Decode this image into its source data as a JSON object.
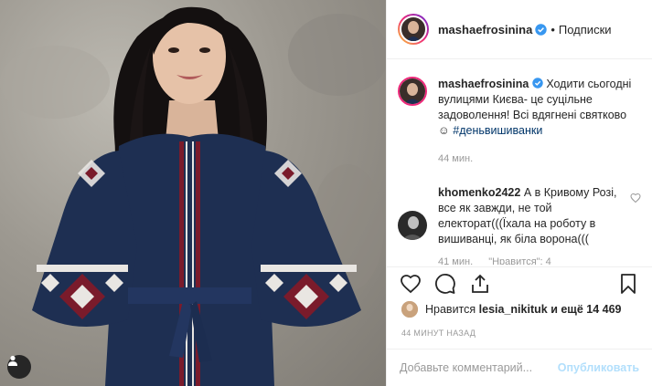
{
  "post": {
    "username": "mashaefrosinina",
    "follow_label": "Подписки",
    "caption": {
      "text": "Ходити сьогодні вулицями Києва- це суцільне задоволення! Всі вдягнені святково ☺",
      "hashtag": "#деньвишиванки",
      "time": "44 мин."
    }
  },
  "comments": [
    {
      "username": "khomenko2422",
      "text": "А в Кривому Розі, все як завжди, не той електорат(((Їхала на роботу в вишиванці, як біла ворона(((",
      "time": "41 мин.",
      "likes": "\"Нравится\": 4"
    }
  ],
  "likes": {
    "prefix": "Нравится",
    "user": "lesia_nikituk",
    "suffix": "и ещё 14 469"
  },
  "timestamp": "44 минут назад",
  "add_comment": {
    "placeholder": "Добавьте комментарий...",
    "post_label": "Опубликовать"
  },
  "colors": {
    "accent_link": "#003569",
    "post_button_disabled": "#b2dffc",
    "verified_blue": "#3897f0",
    "muted": "#999999"
  },
  "icons": {
    "like": "heart-icon",
    "comment": "comment-icon",
    "share": "share-icon",
    "save": "bookmark-icon",
    "tag": "user-tag-icon",
    "verified": "verified-badge-icon"
  }
}
